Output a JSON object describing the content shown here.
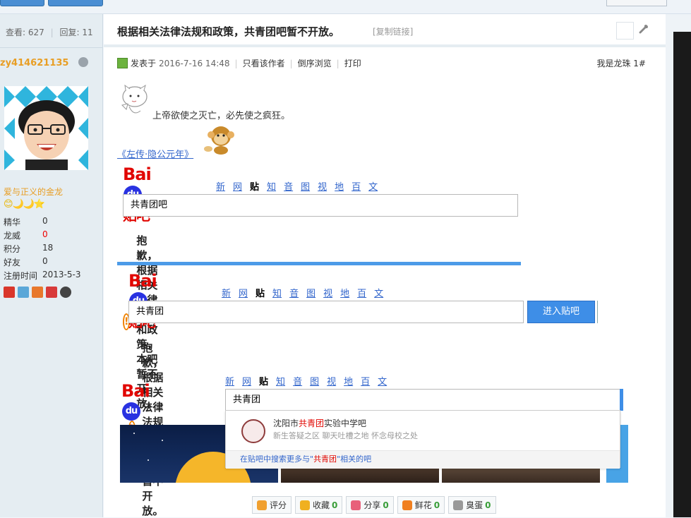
{
  "stats": {
    "views_label": "查看:",
    "views": "627",
    "replies_label": "回复:",
    "replies": "11"
  },
  "author": {
    "name": "zy414621135",
    "title": "爱与正义的金龙",
    "level_icons": "😊🌙🌙⭐"
  },
  "profile": [
    {
      "key": "精华",
      "value": "0",
      "red": false
    },
    {
      "key": "龙威",
      "value": "0",
      "red": true
    },
    {
      "key": "积分",
      "value": "18",
      "red": false
    },
    {
      "key": "好友",
      "value": "0",
      "red": false
    },
    {
      "key": "注册时间",
      "value": "2013-5-3",
      "red": false
    }
  ],
  "post": {
    "title": "根据相关法律法规和政策，共青团吧暂不开放。",
    "copy_link": "[复制链接]",
    "posted_on": "发表于",
    "date": "2016-7-16 14:48",
    "only_author": "只看该作者",
    "reverse": "倒序浏览",
    "print": "打印",
    "floor": "我是龙珠 1#",
    "quote": "上帝欲使之灭亡，必先使之疯狂。",
    "link": "《左传·隐公元年》"
  },
  "baidu": {
    "logo_bai": "Bai",
    "logo_du": "du",
    "logo_tieba": "贴吧",
    "nav": [
      "新闻",
      "网页",
      "贴吧",
      "知道",
      "音乐",
      "图片",
      "视频",
      "地图",
      "百科",
      "文库"
    ],
    "current_nav": "贴吧"
  },
  "shot1": {
    "search_value": "共青团吧",
    "warning": "抱歉，根据相关法律法规和政策，本吧暂不开放。"
  },
  "shot2": {
    "search_value": "共青团",
    "enter_button": "进入贴吧",
    "warning": "抱歉，根据相关法律法规和政策，本吧暂不开放。"
  },
  "shot3": {
    "search_value": "共青团",
    "suggest_name_pre": "沈阳市",
    "suggest_name_hl": "共青团",
    "suggest_name_post": "实验中学吧",
    "suggest_desc": "新生答疑之区 聊天吐槽之地 怀念母校之处",
    "more_pre": "在贴吧中搜索更多与\"",
    "more_hl": "共青团",
    "more_post": "\"相关的吧"
  },
  "actions": [
    {
      "label": "评分",
      "count": "",
      "color": "#f0a030"
    },
    {
      "label": "收藏",
      "count": "0",
      "color": "#f0b020"
    },
    {
      "label": "分享",
      "count": "0",
      "color": "#e8607a"
    },
    {
      "label": "鲜花",
      "count": "0",
      "color": "#f08020"
    },
    {
      "label": "臭蛋",
      "count": "0",
      "color": "#999999"
    }
  ],
  "colors": {
    "accent": "#3366cc",
    "author": "#e89e24",
    "baidu_red": "#e10601",
    "baidu_blue": "#2932e1"
  }
}
